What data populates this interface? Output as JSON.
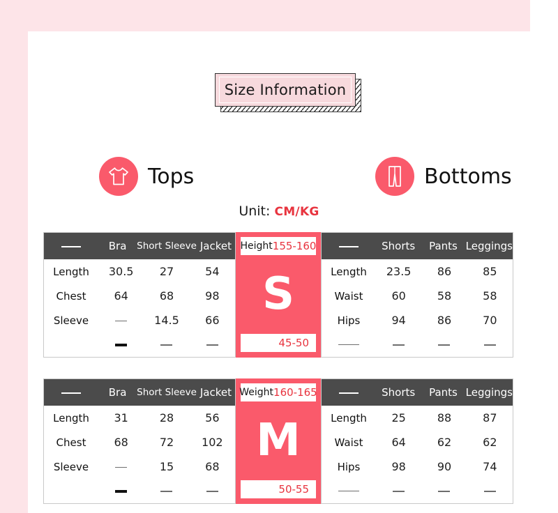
{
  "title": {
    "text": "Size Information"
  },
  "categories": [
    {
      "label": "Tops",
      "icon": "tshirt-icon"
    },
    {
      "label": "Bottoms",
      "icon": "pants-icon"
    }
  ],
  "unit": {
    "prefix": "Unit: ",
    "value": "CM/KG"
  },
  "colors": {
    "accent": "#fa5a6b",
    "accent_text": "#e8343f",
    "header_bg": "#4b4b4b",
    "page_frame": "#fde4e8",
    "title_bg": "#f7d9dd"
  },
  "blocks": [
    {
      "size": {
        "head_label": "Height",
        "head_range": "155-160",
        "letter": "S",
        "foot_range": "45-50"
      },
      "left_table": {
        "headers": [
          "—",
          "Bra",
          "Short Sleeve",
          "Jacket"
        ],
        "rows": [
          {
            "label": "Length",
            "values": [
              "30.5",
              "27",
              "54"
            ]
          },
          {
            "label": "Chest",
            "values": [
              "64",
              "68",
              "98"
            ]
          },
          {
            "label": "Sleeve",
            "values": [
              "—",
              "14.5",
              "66"
            ]
          },
          {
            "label": "",
            "values": [
              "—",
              "—",
              "—"
            ]
          }
        ]
      },
      "right_table": {
        "headers": [
          "—",
          "Shorts",
          "Pants",
          "Leggings"
        ],
        "rows": [
          {
            "label": "Length",
            "values": [
              "23.5",
              "86",
              "85"
            ]
          },
          {
            "label": "Waist",
            "values": [
              "60",
              "58",
              "58"
            ]
          },
          {
            "label": "Hips",
            "values": [
              "94",
              "86",
              "70"
            ]
          },
          {
            "label": "—",
            "values": [
              "—",
              "—",
              "—"
            ]
          }
        ]
      }
    },
    {
      "size": {
        "head_label": "Weight",
        "head_range": "160-165",
        "letter": "M",
        "foot_range": "50-55"
      },
      "left_table": {
        "headers": [
          "—",
          "Bra",
          "Short Sleeve",
          "Jacket"
        ],
        "rows": [
          {
            "label": "Length",
            "values": [
              "31",
              "28",
              "56"
            ]
          },
          {
            "label": "Chest",
            "values": [
              "68",
              "72",
              "102"
            ]
          },
          {
            "label": "Sleeve",
            "values": [
              "—",
              "15",
              "68"
            ]
          },
          {
            "label": "",
            "values": [
              "—",
              "—",
              "—"
            ]
          }
        ]
      },
      "right_table": {
        "headers": [
          "—",
          "Shorts",
          "Pants",
          "Leggings"
        ],
        "rows": [
          {
            "label": "Length",
            "values": [
              "25",
              "88",
              "87"
            ]
          },
          {
            "label": "Waist",
            "values": [
              "64",
              "62",
              "62"
            ]
          },
          {
            "label": "Hips",
            "values": [
              "98",
              "90",
              "74"
            ]
          },
          {
            "label": "—",
            "values": [
              "—",
              "—",
              "—"
            ]
          }
        ]
      }
    }
  ]
}
